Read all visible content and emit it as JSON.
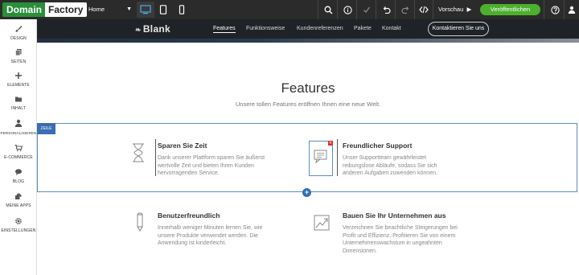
{
  "editor": {
    "logo_part1": "Domain",
    "logo_part2": "Factory",
    "page_select": "Home",
    "device_icons": [
      "desktop-icon",
      "tablet-icon",
      "phone-icon"
    ],
    "toolbar_icons": [
      "search-icon",
      "info-icon",
      "check-icon",
      "undo-icon",
      "redo-icon",
      "code-icon",
      "help-icon"
    ],
    "preview_label": "Vorschau",
    "publish_label": "Veröffentlichen"
  },
  "sidebar": {
    "items": [
      {
        "label": "DESIGN",
        "icon": "brush-icon"
      },
      {
        "label": "SEITEN",
        "icon": "pages-icon"
      },
      {
        "label": "ELEMENTE",
        "icon": "plus-icon"
      },
      {
        "label": "INHALT",
        "icon": "folder-icon"
      },
      {
        "label": "PERSONALISIEREN",
        "icon": "user-icon"
      },
      {
        "label": "E-COMMERCE",
        "icon": "cart-icon"
      },
      {
        "label": "BLOG",
        "icon": "comment-icon"
      },
      {
        "label": "MEINE APPS",
        "icon": "puzzle-icon"
      },
      {
        "label": "EINSTELLUNGEN",
        "icon": "gear-icon"
      }
    ]
  },
  "site": {
    "brand": "Blank",
    "nav": [
      "Features",
      "Funktionsweise",
      "Kundenreferenzen",
      "Pakete",
      "Kontakt"
    ],
    "nav_active": "Features",
    "contact_button": "Kontaktieren Sie uns",
    "section_title": "Features",
    "section_subtitle": "Unsere tollen Features eröffnen Ihnen eine neue Welt.",
    "row_tag": "ZEILE",
    "features": [
      {
        "title": "Sparen Sie Zeit",
        "text": "Dank unserer Plattform sparen Sie äußerst wertvolle Zeit und bieten Ihren Kunden hervorragenden Service.",
        "icon": "hourglass-icon"
      },
      {
        "title": "Freundlicher Support",
        "text": "Unser Supportteam gewährleistet reibungslose Abläufe, sodass Sie sich anderen Aufgaben zuwenden können.",
        "icon": "chat-icon"
      },
      {
        "title": "Benutzerfreundlich",
        "text": "Innerhalb weniger Minuten lernen Sie, wie unsere Produkte verwendet werden. Die Anwendung ist kinderleicht.",
        "icon": "pencil-icon"
      },
      {
        "title": "Bauen Sie Ihr Unternehmen aus",
        "text": "Verzeichnen Sie beachtliche Steigerungen bei Profit und Effizienz. Profitieren Sie von einem Unternehmenswachstum in ungeahnten Dimensionen.",
        "icon": "growth-chart-icon"
      }
    ]
  },
  "colors": {
    "topbar": "#2b2b2b",
    "logo_green": "#2a8f3a",
    "publish_green": "#4caf2d",
    "selection_blue": "#3b6db3",
    "site_nav": "#1f2327"
  }
}
